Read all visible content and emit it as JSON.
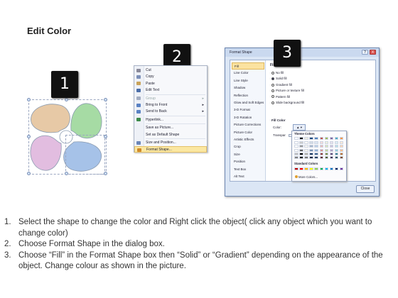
{
  "title": "Edit Color",
  "badges": [
    "1",
    "2",
    "3"
  ],
  "context_menu": {
    "items": [
      {
        "label": "Cut",
        "icon": "scissors-icon",
        "color": "#8a8a9a"
      },
      {
        "label": "Copy",
        "icon": "copy-icon",
        "color": "#7b8fb8"
      },
      {
        "label": "Paste",
        "icon": "paste-icon",
        "color": "#c9a35a"
      },
      {
        "label": "Edit Text",
        "icon": "edit-text-icon",
        "color": "#4a6ea9"
      },
      {
        "label": "Group",
        "icon": "group-icon",
        "color": "#a3adc2",
        "submenu": true,
        "disabled": true
      },
      {
        "label": "Bring to Front",
        "icon": "bring-front-icon",
        "color": "#5a82c4",
        "submenu": true
      },
      {
        "label": "Send to Back",
        "icon": "send-back-icon",
        "color": "#5a82c4",
        "submenu": true
      },
      {
        "label": "Hyperlink...",
        "icon": "hyperlink-icon",
        "color": "#3b8a4a"
      },
      {
        "label": "Save as Picture...",
        "icon": "",
        "color": ""
      },
      {
        "label": "Set as Default Shape",
        "icon": "",
        "color": ""
      },
      {
        "label": "Size and Position...",
        "icon": "size-position-icon",
        "color": "#6a86b8"
      },
      {
        "label": "Format Shape...",
        "icon": "format-shape-icon",
        "color": "#d08a2a",
        "highlighted": true
      }
    ]
  },
  "dialog": {
    "title": "Format Shape",
    "help": "?",
    "close_x": "X",
    "nav": [
      "Fill",
      "Line Color",
      "Line Style",
      "Shadow",
      "Reflection",
      "Glow and Soft Edges",
      "3-D Format",
      "3-D Rotation",
      "Picture Corrections",
      "Picture Color",
      "Artistic Effects",
      "Crop",
      "Size",
      "Position",
      "Text Box",
      "Alt Text"
    ],
    "nav_selected": 0,
    "pane_title": "Fill",
    "options": [
      {
        "label": "No fill",
        "on": false
      },
      {
        "label": "Solid fill",
        "on": true
      },
      {
        "label": "Gradient fill",
        "on": false
      },
      {
        "label": "Picture or texture fill",
        "on": false
      },
      {
        "label": "Pattern fill",
        "on": false
      },
      {
        "label": "Slide background fill",
        "on": false
      }
    ],
    "fill_color_label": "Fill Color",
    "color_label": "Color:",
    "transparency_label": "Transpar",
    "palette": {
      "theme_title": "Theme Colors",
      "standard_title": "Standard Colors",
      "more": "More Colors...",
      "theme_top": [
        "#ffffff",
        "#000000",
        "#eeece1",
        "#1f497d",
        "#4f81bd",
        "#c0504d",
        "#9bbb59",
        "#8064a2",
        "#4bacc6",
        "#f79646"
      ],
      "standard": [
        "#c00000",
        "#ff0000",
        "#ffc000",
        "#ffff00",
        "#92d050",
        "#00b050",
        "#00b0f0",
        "#0070c0",
        "#002060",
        "#7030a0"
      ]
    },
    "close_button": "Close"
  },
  "steps": [
    {
      "num": "1.",
      "text": "Select the shape to change the color and Right click the object( click any object which you want to change color)"
    },
    {
      "num": "2.",
      "text": "Choose Format Shape in the dialog box."
    },
    {
      "num": "3.",
      "text": "Choose “Fill” in the Format Shape box then “Solid” or “Gradient” depending on the appearance of the object. Change colour as shown in the picture."
    }
  ],
  "shape_colors": [
    "#e7c9a6",
    "#a6dba4",
    "#a6c2e8",
    "#e2bde0"
  ]
}
